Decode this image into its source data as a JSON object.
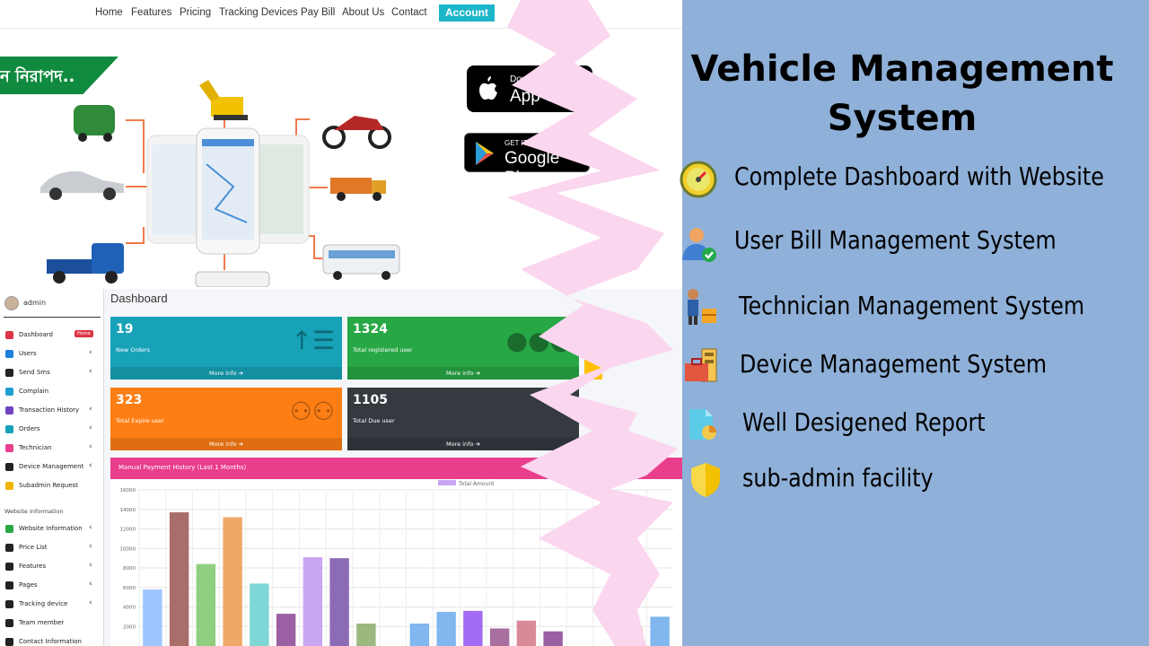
{
  "nav": {
    "items": [
      "Home",
      "Features",
      "Pricing",
      "Tracking Devices",
      "Pay Bill",
      "About Us",
      "Contact"
    ],
    "account": "Account"
  },
  "hero": {
    "bangla_text": "ন নিরাপদ..",
    "apple_small": "Download on the",
    "apple_big": "App Store",
    "google_small": "GET IT ON",
    "google_big": "Google Play"
  },
  "dashboard": {
    "admin": "admin",
    "title": "Dashboard",
    "home_badge": "Home",
    "sidebar": [
      {
        "label": "Dashboard",
        "color": "#dc3545",
        "arrow": ""
      },
      {
        "label": "Users",
        "color": "#1e7fd9",
        "arrow": "‹"
      },
      {
        "label": "Send Sms",
        "color": "#222222",
        "arrow": "‹"
      },
      {
        "label": "Complain",
        "color": "#20a0d0",
        "arrow": ""
      },
      {
        "label": "Transaction History",
        "color": "#6f42c1",
        "arrow": "‹"
      },
      {
        "label": "Orders",
        "color": "#17a2b8",
        "arrow": "‹"
      },
      {
        "label": "Technician",
        "color": "#e83e8c",
        "arrow": "‹"
      },
      {
        "label": "Device Management",
        "color": "#222222",
        "arrow": "‹"
      },
      {
        "label": "Subadmin Request",
        "color": "#f0b400",
        "arrow": ""
      }
    ],
    "section_label": "Website Information",
    "sidebar2": [
      {
        "label": "Website Information",
        "color": "#28a745",
        "arrow": "‹"
      },
      {
        "label": "Price List",
        "color": "#222222",
        "arrow": "‹"
      },
      {
        "label": "Features",
        "color": "#222222",
        "arrow": "‹"
      },
      {
        "label": "Pages",
        "color": "#222222",
        "arrow": "‹"
      },
      {
        "label": "Tracking device",
        "color": "#222222",
        "arrow": "‹"
      },
      {
        "label": "Team member",
        "color": "#222222",
        "arrow": ""
      },
      {
        "label": "Contact Information",
        "color": "#222222",
        "arrow": ""
      }
    ],
    "cards": [
      {
        "value": "19",
        "label": "New Orders",
        "more": "More info ➔",
        "color": "#17a2b8"
      },
      {
        "value": "1324",
        "label": "Total registered user",
        "more": "More info ➔",
        "color": "#28a745"
      },
      {
        "value": "323",
        "label": "Total Expire user",
        "more": "More info ➔",
        "color": "#fd7e14"
      },
      {
        "value": "1105",
        "label": "Total Due user",
        "more": "More info ➔",
        "color": "#343a40"
      }
    ],
    "chart_title": "Manual Payment History (Last 1 Months)"
  },
  "chart_data": {
    "type": "bar",
    "title": "Manual Payment History (Last 1 Months)",
    "legend": [
      "Total Amount"
    ],
    "legend_position": "top-center",
    "yticks": [
      "16000",
      "14000",
      "12000",
      "10000",
      "8000",
      "6000",
      "4000",
      "2000"
    ],
    "ylim": [
      0,
      16000
    ],
    "grid": true,
    "series": [
      {
        "name": "Total Amount",
        "values": [
          5800,
          13700,
          8400,
          13200,
          6400,
          3300,
          9100,
          9000,
          2300,
          0,
          2300,
          3500,
          3600,
          1800,
          2600,
          1500,
          0,
          0,
          1900,
          3000
        ],
        "colors": [
          "#9ec5fe",
          "#a96e6a",
          "#8fcf7f",
          "#f0a868",
          "#7fd6d6",
          "#9b5fa3",
          "#c9a6f2",
          "#8c6bb5",
          "#9bb87f",
          "#cccccc",
          "#7fb7ee",
          "#7fb7ee",
          "#a26cf2",
          "#a86f9f",
          "#d88a98",
          "#9b5fa3",
          "#cccccc",
          "#cccccc",
          "#f4d7a0",
          "#7fb7ee"
        ]
      }
    ]
  },
  "headline": "Vehicle Management System",
  "features": [
    {
      "text": "Complete Dashboard with Website",
      "icon": "gauge-icon"
    },
    {
      "text": "User Bill Management System",
      "icon": "user-check-icon"
    },
    {
      "text": "Technician Management System",
      "icon": "technician-icon"
    },
    {
      "text": "Device Management System",
      "icon": "toolbox-icon"
    },
    {
      "text": "Well Desigened Report",
      "icon": "report-icon"
    },
    {
      "text": "sub-admin facility",
      "icon": "shield-icon"
    }
  ],
  "colors": {
    "background": "#8fb0d8",
    "brush": "#fbd6ef",
    "accent": "#1cb5c9"
  }
}
